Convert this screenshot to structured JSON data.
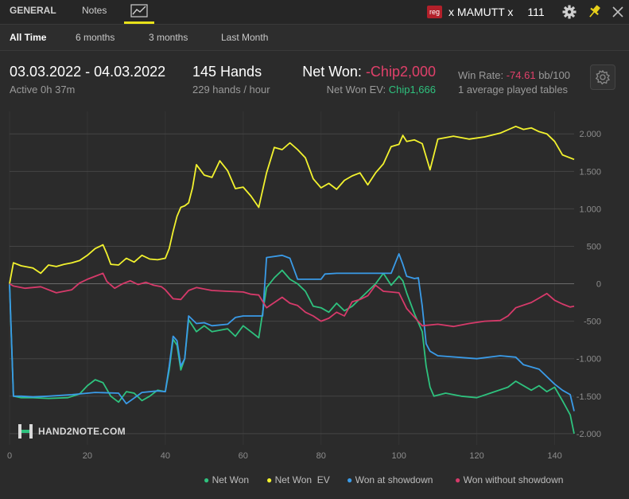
{
  "header": {
    "tabs": {
      "general": "GENERAL",
      "notes": "Notes"
    },
    "chart_tab_icon": "line-chart-icon",
    "player": {
      "badge": "reg",
      "name": "x MAMUTT x",
      "hands": "111"
    },
    "icons": [
      "gear-icon",
      "pin-icon",
      "close-icon"
    ],
    "accent_color": "#e8e21a"
  },
  "filters": {
    "all": "All Time",
    "six": "6 months",
    "three": "3 months",
    "last": "Last Month"
  },
  "stats": {
    "date_range": "03.03.2022 - 04.03.2022",
    "active": "Active 0h 37m",
    "hands": "145 Hands",
    "rate": "229 hands / hour",
    "net_won_label": "Net Won:",
    "net_won_value": "-Chip2,000",
    "ev_label": "Net Won  EV:",
    "ev_value": "Chip1,666",
    "winrate_label": "Win Rate:",
    "winrate_value": "-74.61",
    "winrate_unit": "bb/100",
    "tables": "1 average played tables"
  },
  "watermark": "HAND2NOTE.COM",
  "chart_data": {
    "type": "line",
    "xlim": [
      0,
      145
    ],
    "ylim": [
      -2150,
      2300
    ],
    "x_ticks": [
      0,
      20,
      40,
      60,
      80,
      100,
      120,
      140
    ],
    "y_ticks": [
      2000,
      1500,
      1000,
      500,
      0,
      -500,
      -1000,
      -1500,
      -2000
    ],
    "y_tick_labels": [
      "2.000",
      "1.500",
      "1.000",
      "500",
      "0",
      "-500",
      "-1.000",
      "-1.500",
      "-2.000"
    ],
    "grid": true,
    "legend_position": "bottom-right",
    "series": [
      {
        "name": "Net Won",
        "color": "#2ec27e",
        "points": [
          [
            0,
            0
          ],
          [
            1,
            -1500
          ],
          [
            3,
            -1520
          ],
          [
            6,
            -1520
          ],
          [
            10,
            -1530
          ],
          [
            15,
            -1520
          ],
          [
            18,
            -1470
          ],
          [
            20,
            -1360
          ],
          [
            22,
            -1280
          ],
          [
            24,
            -1320
          ],
          [
            26,
            -1500
          ],
          [
            28,
            -1580
          ],
          [
            30,
            -1440
          ],
          [
            32,
            -1460
          ],
          [
            34,
            -1560
          ],
          [
            36,
            -1500
          ],
          [
            38,
            -1420
          ],
          [
            40,
            -1440
          ],
          [
            41,
            -1150
          ],
          [
            42,
            -740
          ],
          [
            43,
            -820
          ],
          [
            44,
            -1150
          ],
          [
            45,
            -1000
          ],
          [
            46,
            -480
          ],
          [
            48,
            -640
          ],
          [
            50,
            -560
          ],
          [
            52,
            -640
          ],
          [
            56,
            -600
          ],
          [
            58,
            -700
          ],
          [
            60,
            -560
          ],
          [
            62,
            -640
          ],
          [
            64,
            -720
          ],
          [
            66,
            -50
          ],
          [
            68,
            80
          ],
          [
            70,
            180
          ],
          [
            72,
            60
          ],
          [
            74,
            0
          ],
          [
            76,
            -100
          ],
          [
            78,
            -300
          ],
          [
            80,
            -320
          ],
          [
            82,
            -380
          ],
          [
            84,
            -260
          ],
          [
            86,
            -360
          ],
          [
            88,
            -300
          ],
          [
            90,
            -200
          ],
          [
            92,
            -100
          ],
          [
            94,
            0
          ],
          [
            96,
            140
          ],
          [
            98,
            -20
          ],
          [
            100,
            100
          ],
          [
            101,
            40
          ],
          [
            102,
            -120
          ],
          [
            104,
            -400
          ],
          [
            106,
            -640
          ],
          [
            107,
            -1100
          ],
          [
            108,
            -1380
          ],
          [
            109,
            -1500
          ],
          [
            112,
            -1460
          ],
          [
            116,
            -1500
          ],
          [
            120,
            -1520
          ],
          [
            124,
            -1450
          ],
          [
            128,
            -1380
          ],
          [
            130,
            -1300
          ],
          [
            134,
            -1420
          ],
          [
            136,
            -1360
          ],
          [
            138,
            -1440
          ],
          [
            140,
            -1380
          ],
          [
            142,
            -1560
          ],
          [
            144,
            -1750
          ],
          [
            145,
            -2000
          ]
        ]
      },
      {
        "name": "Net Won  EV",
        "color": "#f2f22e",
        "points": [
          [
            0,
            0
          ],
          [
            1,
            280
          ],
          [
            3,
            240
          ],
          [
            6,
            210
          ],
          [
            8,
            140
          ],
          [
            10,
            250
          ],
          [
            12,
            230
          ],
          [
            14,
            260
          ],
          [
            16,
            280
          ],
          [
            18,
            310
          ],
          [
            20,
            380
          ],
          [
            22,
            470
          ],
          [
            24,
            520
          ],
          [
            25,
            400
          ],
          [
            26,
            260
          ],
          [
            28,
            250
          ],
          [
            30,
            340
          ],
          [
            32,
            290
          ],
          [
            34,
            380
          ],
          [
            36,
            330
          ],
          [
            38,
            320
          ],
          [
            40,
            340
          ],
          [
            41,
            470
          ],
          [
            42,
            700
          ],
          [
            43,
            900
          ],
          [
            44,
            1020
          ],
          [
            45,
            1040
          ],
          [
            46,
            1080
          ],
          [
            47,
            1280
          ],
          [
            48,
            1590
          ],
          [
            50,
            1450
          ],
          [
            52,
            1420
          ],
          [
            54,
            1640
          ],
          [
            56,
            1510
          ],
          [
            58,
            1270
          ],
          [
            60,
            1290
          ],
          [
            62,
            1170
          ],
          [
            64,
            1020
          ],
          [
            66,
            1480
          ],
          [
            68,
            1820
          ],
          [
            70,
            1790
          ],
          [
            72,
            1880
          ],
          [
            74,
            1790
          ],
          [
            76,
            1680
          ],
          [
            78,
            1400
          ],
          [
            80,
            1280
          ],
          [
            82,
            1340
          ],
          [
            84,
            1260
          ],
          [
            86,
            1380
          ],
          [
            88,
            1440
          ],
          [
            90,
            1480
          ],
          [
            92,
            1320
          ],
          [
            94,
            1480
          ],
          [
            96,
            1600
          ],
          [
            98,
            1830
          ],
          [
            100,
            1860
          ],
          [
            101,
            1980
          ],
          [
            102,
            1900
          ],
          [
            104,
            1920
          ],
          [
            106,
            1870
          ],
          [
            108,
            1520
          ],
          [
            110,
            1930
          ],
          [
            114,
            1970
          ],
          [
            118,
            1930
          ],
          [
            122,
            1960
          ],
          [
            126,
            2010
          ],
          [
            130,
            2100
          ],
          [
            132,
            2060
          ],
          [
            134,
            2080
          ],
          [
            136,
            2030
          ],
          [
            138,
            2000
          ],
          [
            140,
            1900
          ],
          [
            142,
            1720
          ],
          [
            145,
            1660
          ]
        ]
      },
      {
        "name": "Won at showdown",
        "color": "#3a9be8",
        "points": [
          [
            0,
            0
          ],
          [
            1,
            -1500
          ],
          [
            3,
            -1500
          ],
          [
            6,
            -1510
          ],
          [
            10,
            -1500
          ],
          [
            16,
            -1480
          ],
          [
            22,
            -1450
          ],
          [
            28,
            -1460
          ],
          [
            30,
            -1600
          ],
          [
            34,
            -1450
          ],
          [
            38,
            -1430
          ],
          [
            40,
            -1440
          ],
          [
            41,
            -1100
          ],
          [
            42,
            -700
          ],
          [
            43,
            -760
          ],
          [
            44,
            -1100
          ],
          [
            45,
            -1000
          ],
          [
            46,
            -430
          ],
          [
            48,
            -530
          ],
          [
            50,
            -520
          ],
          [
            52,
            -560
          ],
          [
            56,
            -540
          ],
          [
            58,
            -450
          ],
          [
            60,
            -430
          ],
          [
            62,
            -430
          ],
          [
            64,
            -430
          ],
          [
            65,
            -430
          ],
          [
            66,
            350
          ],
          [
            70,
            380
          ],
          [
            72,
            340
          ],
          [
            74,
            60
          ],
          [
            78,
            60
          ],
          [
            80,
            60
          ],
          [
            81,
            130
          ],
          [
            84,
            140
          ],
          [
            98,
            140
          ],
          [
            100,
            400
          ],
          [
            101,
            260
          ],
          [
            102,
            100
          ],
          [
            104,
            70
          ],
          [
            105,
            80
          ],
          [
            106,
            -300
          ],
          [
            107,
            -800
          ],
          [
            108,
            -900
          ],
          [
            110,
            -960
          ],
          [
            120,
            -1000
          ],
          [
            126,
            -960
          ],
          [
            130,
            -980
          ],
          [
            132,
            -1080
          ],
          [
            136,
            -1140
          ],
          [
            140,
            -1340
          ],
          [
            142,
            -1420
          ],
          [
            144,
            -1480
          ],
          [
            145,
            -1700
          ]
        ]
      },
      {
        "name": "Won without showdown",
        "color": "#d63a6a",
        "points": [
          [
            0,
            0
          ],
          [
            1,
            -30
          ],
          [
            4,
            -60
          ],
          [
            8,
            -40
          ],
          [
            12,
            -120
          ],
          [
            16,
            -80
          ],
          [
            18,
            10
          ],
          [
            20,
            60
          ],
          [
            22,
            100
          ],
          [
            24,
            140
          ],
          [
            25,
            30
          ],
          [
            27,
            -60
          ],
          [
            29,
            0
          ],
          [
            31,
            40
          ],
          [
            33,
            -10
          ],
          [
            35,
            20
          ],
          [
            37,
            -20
          ],
          [
            39,
            -40
          ],
          [
            40,
            -80
          ],
          [
            42,
            -200
          ],
          [
            44,
            -210
          ],
          [
            46,
            -90
          ],
          [
            48,
            -50
          ],
          [
            52,
            -90
          ],
          [
            56,
            -100
          ],
          [
            60,
            -110
          ],
          [
            62,
            -140
          ],
          [
            64,
            -150
          ],
          [
            66,
            -320
          ],
          [
            68,
            -250
          ],
          [
            70,
            -180
          ],
          [
            72,
            -260
          ],
          [
            74,
            -290
          ],
          [
            76,
            -380
          ],
          [
            78,
            -430
          ],
          [
            80,
            -500
          ],
          [
            82,
            -460
          ],
          [
            84,
            -380
          ],
          [
            86,
            -430
          ],
          [
            88,
            -240
          ],
          [
            90,
            -210
          ],
          [
            92,
            -160
          ],
          [
            94,
            -20
          ],
          [
            96,
            -100
          ],
          [
            98,
            -110
          ],
          [
            100,
            -120
          ],
          [
            102,
            -330
          ],
          [
            106,
            -560
          ],
          [
            110,
            -540
          ],
          [
            114,
            -570
          ],
          [
            118,
            -530
          ],
          [
            122,
            -500
          ],
          [
            126,
            -490
          ],
          [
            128,
            -430
          ],
          [
            130,
            -320
          ],
          [
            134,
            -250
          ],
          [
            136,
            -190
          ],
          [
            138,
            -130
          ],
          [
            140,
            -220
          ],
          [
            142,
            -270
          ],
          [
            144,
            -310
          ],
          [
            145,
            -300
          ]
        ]
      }
    ]
  }
}
